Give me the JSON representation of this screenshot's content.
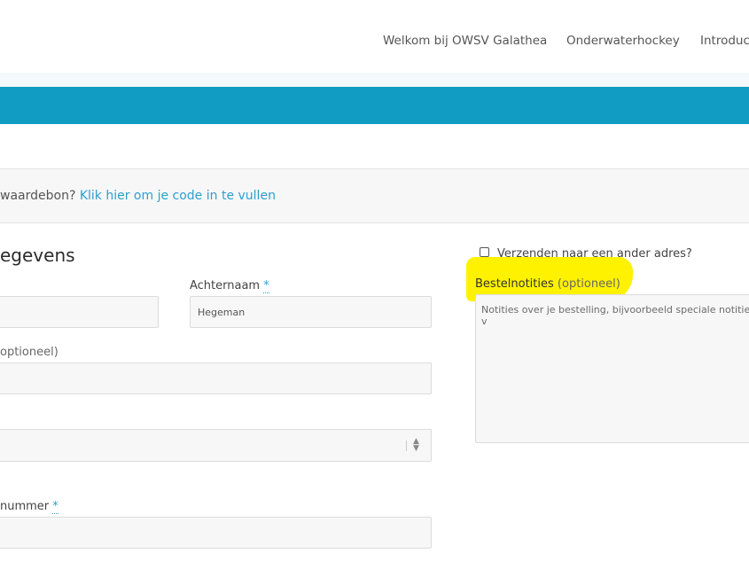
{
  "nav": {
    "items": [
      {
        "label": "Welkom bij OWSV Galathea"
      },
      {
        "label": "Onderwaterhockey"
      },
      {
        "label": "Introduc"
      }
    ]
  },
  "coupon": {
    "text": "waardebon?",
    "link": "Klik hier om je code in te vullen"
  },
  "billing": {
    "title": "egevens",
    "lastname": {
      "label": "Achternaam",
      "required": "*",
      "value": "Hegeman"
    },
    "company": {
      "label": "optioneel)"
    },
    "phone": {
      "label": "nummer",
      "required": "*"
    }
  },
  "shipping": {
    "checkbox_label": "Verzenden naar een ander adres?",
    "notes_label": "Bestelnotities",
    "notes_optional": "(optioneel)",
    "notes_placeholder": "Notities over je bestelling, bijvoorbeeld speciale notities v"
  },
  "colors": {
    "banner": "#119dc3",
    "link": "#2e9fd0",
    "highlight": "#fff200"
  }
}
